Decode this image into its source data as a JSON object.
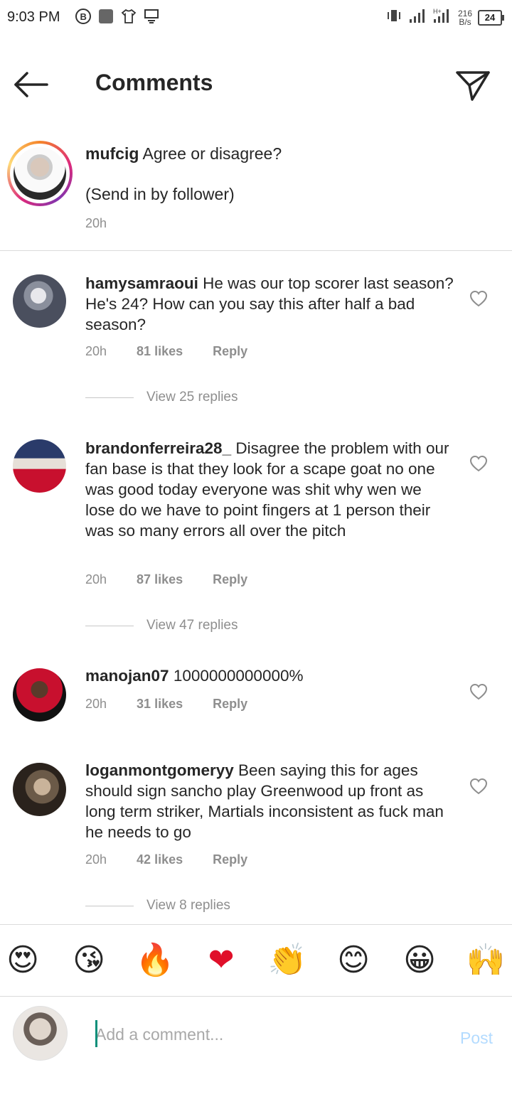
{
  "status_bar": {
    "time": "9:03 PM",
    "speed_value": "216",
    "speed_unit": "B/s",
    "battery": "24",
    "left_icons": [
      "b-circle-icon",
      "square-app-icon",
      "shirt-icon",
      "monitor-icon"
    ],
    "right_icons": [
      "vibrate-icon",
      "signal-icon",
      "signal-h-plus-icon",
      "battery-icon"
    ]
  },
  "header": {
    "title": "Comments",
    "back_icon": "arrow-left-icon",
    "send_icon": "paper-plane-icon"
  },
  "caption": {
    "username": "mufcig",
    "text": "Agree or disagree?",
    "text_line2": "(Send in by follower)",
    "time": "20h"
  },
  "comments": [
    {
      "username": "hamysamraoui",
      "text": "He was our top scorer last season? He's 24?  How can you say this after half a bad season?",
      "time": "20h",
      "likes": "81 likes",
      "reply": "Reply",
      "view_replies": "View 25 replies"
    },
    {
      "username": "brandonferreira28_",
      "text": "Disagree the problem with our fan base is that they look for a scape goat no one was good today everyone was shit why wen we lose do we have to point fingers at 1 person their was so many errors all over the pitch",
      "time": "20h",
      "likes": "87 likes",
      "reply": "Reply",
      "view_replies": "View 47 replies"
    },
    {
      "username": "manojan07",
      "text": "1000000000000%",
      "time": "20h",
      "likes": "31 likes",
      "reply": "Reply"
    },
    {
      "username": "loganmontgomeryy",
      "text": "Been saying this for ages should sign sancho play Greenwood up front as long term striker, Martials inconsistent as fuck man he needs to go",
      "time": "20h",
      "likes": "42 likes",
      "reply": "Reply",
      "view_replies": "View 8 replies"
    }
  ],
  "emoji_bar": [
    "😍",
    "😘",
    "🔥",
    "❤",
    "👏",
    "😊",
    "😀",
    "🙌"
  ],
  "composer": {
    "placeholder": "Add a comment...",
    "post_label": "Post",
    "post_color": "#b3dbff"
  },
  "colors": {
    "text": "#262626",
    "secondary": "#8e8e8e",
    "divider": "#dbdbdb"
  }
}
